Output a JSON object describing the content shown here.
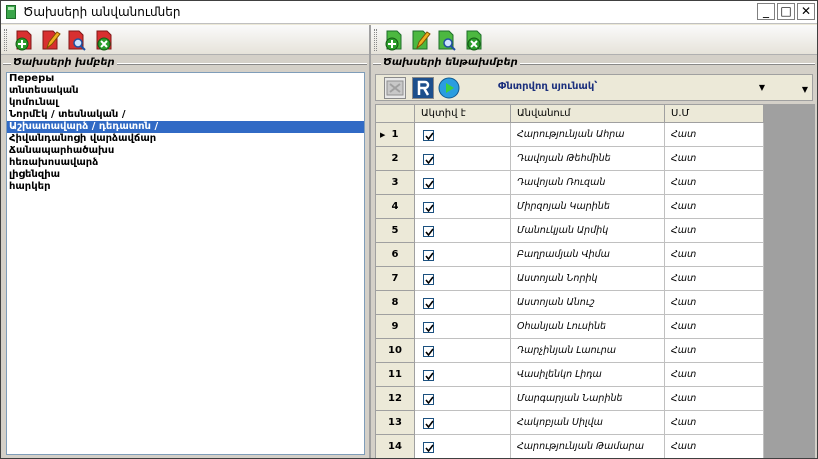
{
  "window": {
    "title": "Ծախսերի անվանումներ",
    "minimize": "_",
    "maximize": "□",
    "close": "✕"
  },
  "left_toolbar": [
    {
      "icon": "add-icon",
      "color": "#2a8d2a"
    },
    {
      "icon": "edit-icon",
      "color": "#e0a000"
    },
    {
      "icon": "search-icon",
      "color": "#3a6fd8"
    },
    {
      "icon": "delete-icon",
      "color": "#d03030"
    }
  ],
  "right_toolbar": [
    {
      "icon": "add-icon",
      "color": "#2a8d2a"
    },
    {
      "icon": "edit-icon",
      "color": "#e0a000"
    },
    {
      "icon": "search-icon",
      "color": "#3a6fd8"
    },
    {
      "icon": "delete-icon",
      "color": "#d03030"
    }
  ],
  "left_group_title": "Ծախսերի խմբեր",
  "right_group_title": "Ծախսերի ենթախմբեր",
  "groups": [
    "Переры",
    "տնտեսական",
    "կոմունալ",
    "Նորմէկ / տեսնական /",
    "Աշխատավարձ / դեդատոն /",
    "Հիվանդանոցի վարձավճար",
    "Ճանապարհածախս",
    "հեռախոսավարձ",
    "լիցենզիա",
    "հարկեր"
  ],
  "selected_group_index": 4,
  "grid_toolbar": {
    "filter_label": "Փնտրվող սյունակ՝"
  },
  "grid": {
    "columns": [
      "Ակտիվ է",
      "Անվանում",
      "Ս.Մ"
    ],
    "rows": [
      {
        "n": "1",
        "active": true,
        "name": "Հարությունյան Ահրա",
        "unit": "Հատ"
      },
      {
        "n": "2",
        "active": true,
        "name": "Դավոյան Թեհմինե",
        "unit": "Հատ"
      },
      {
        "n": "3",
        "active": true,
        "name": "Դավոյան Ռուզան",
        "unit": "Հատ"
      },
      {
        "n": "4",
        "active": true,
        "name": "Միրզոյան Կարինե",
        "unit": "Հատ"
      },
      {
        "n": "5",
        "active": true,
        "name": "Մանուկյան Արմիկ",
        "unit": "Հատ"
      },
      {
        "n": "6",
        "active": true,
        "name": "Բաղրամյան Վիմա",
        "unit": "Հատ"
      },
      {
        "n": "7",
        "active": true,
        "name": "Աստոյան Նորիկ",
        "unit": "Հատ"
      },
      {
        "n": "8",
        "active": true,
        "name": "Աստոյան Անուշ",
        "unit": "Հատ"
      },
      {
        "n": "9",
        "active": true,
        "name": "Օհանյան Լուսինե",
        "unit": "Հատ"
      },
      {
        "n": "10",
        "active": true,
        "name": "Դարչինյան Լաուրա",
        "unit": "Հատ"
      },
      {
        "n": "11",
        "active": true,
        "name": "Վասիլենկո Լիդա",
        "unit": "Հատ"
      },
      {
        "n": "12",
        "active": true,
        "name": "Մարգարյան Նարինե",
        "unit": "Հատ"
      },
      {
        "n": "13",
        "active": true,
        "name": "Հակոբյան Սիլվա",
        "unit": "Հատ"
      },
      {
        "n": "14",
        "active": true,
        "name": "Հարությունյան Թամարա",
        "unit": "Հատ"
      }
    ]
  }
}
